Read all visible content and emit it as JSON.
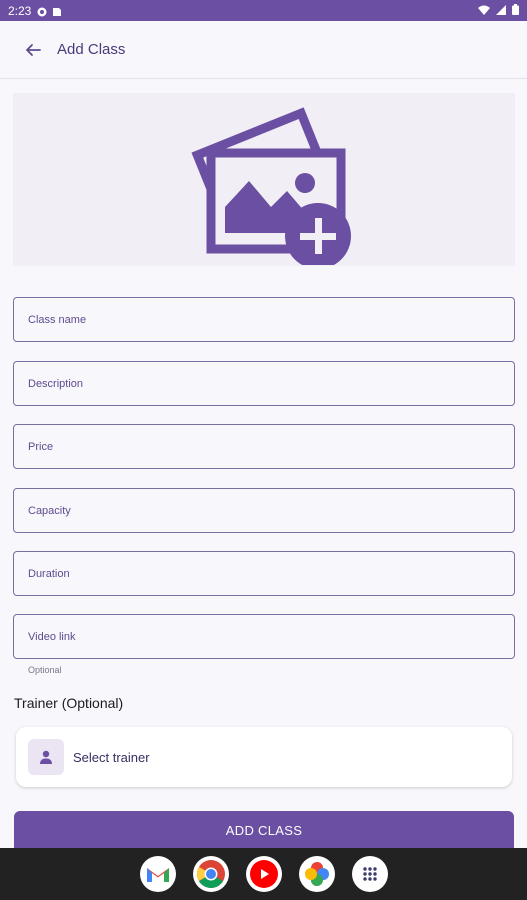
{
  "status_bar": {
    "time": "2:23",
    "icons": [
      "notification-icon",
      "sim-icon",
      "wifi-icon",
      "signal-icon",
      "battery-icon"
    ]
  },
  "app_bar": {
    "back_icon": "arrow-back-icon",
    "title": "Add Class"
  },
  "image_picker": {
    "icon": "add-photo-icon"
  },
  "form": {
    "fields": [
      {
        "placeholder": "Class name",
        "value": ""
      },
      {
        "placeholder": "Description",
        "value": ""
      },
      {
        "placeholder": "Price",
        "value": ""
      },
      {
        "placeholder": "Capacity",
        "value": ""
      },
      {
        "placeholder": "Duration",
        "value": ""
      },
      {
        "placeholder": "Video link",
        "value": ""
      }
    ],
    "video_helper": "Optional"
  },
  "trainer": {
    "label": "Trainer (Optional)",
    "select_text": "Select trainer",
    "icon": "person-icon"
  },
  "submit": {
    "label": "ADD CLASS"
  },
  "dock": {
    "apps": [
      "gmail-icon",
      "chrome-icon",
      "youtube-icon",
      "photos-icon",
      "app-drawer-icon"
    ]
  },
  "colors": {
    "primary": "#6a4fa2",
    "background": "#f8f7fb",
    "field_border": "#7a6ea0"
  }
}
